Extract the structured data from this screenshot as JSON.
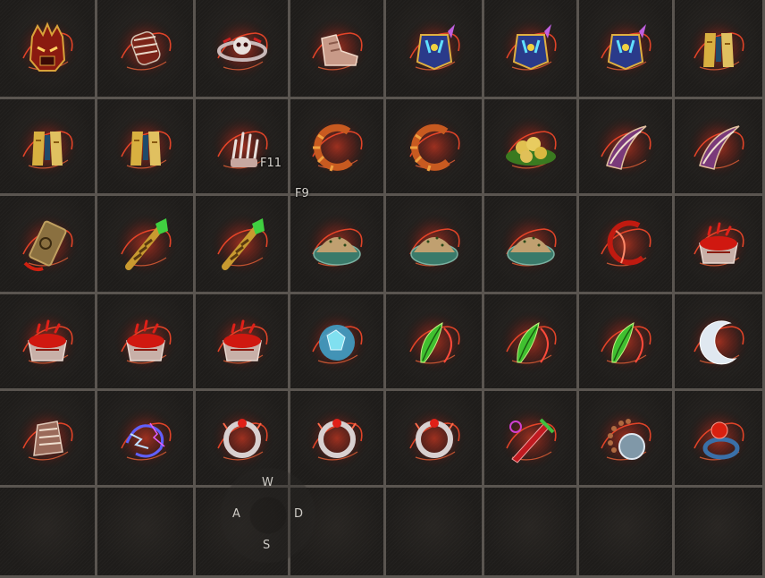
{
  "inventory": {
    "rows": [
      [
        "demon-helmet-icon",
        "armored-gauntlet-icon",
        "skull-belt-icon",
        "leather-boots-icon",
        "jeweled-armor-icon",
        "jeweled-armor-icon",
        "jeweled-armor-icon",
        "gold-robe-icon"
      ],
      [
        "gold-robe-icon",
        "gold-robe-icon",
        "skeletal-glove-icon",
        "spiked-bracelet-icon",
        "spiked-bracelet-icon",
        "fruit-bowl-icon",
        "curved-blade-icon",
        "curved-blade-icon"
      ],
      [
        "ancient-scroll-icon",
        "jade-scepter-icon",
        "jade-scepter-icon",
        "spice-bowl-icon",
        "spice-bowl-icon",
        "spice-bowl-icon",
        "crimson-ring-icon",
        "blood-cauldron-icon"
      ],
      [
        "blood-cauldron-icon",
        "blood-cauldron-icon",
        "blood-cauldron-icon",
        "ice-crystal-icon",
        "green-feather-icon",
        "green-feather-icon",
        "green-feather-icon",
        "silver-crescent-icon"
      ],
      [
        "bone-gauntlet-icon",
        "lightning-dragon-icon",
        "silver-ring-icon",
        "silver-ring-icon",
        "silver-ring-icon",
        "venom-dagger-icon",
        "bead-necklace-icon",
        "ruby-ring-icon"
      ],
      [
        "",
        "",
        "",
        "",
        "",
        "",
        "",
        ""
      ]
    ]
  },
  "hints": {
    "f11": "F11",
    "f9": "F9"
  },
  "dpad": {
    "up": "W",
    "left": "A",
    "right": "D",
    "down": "S"
  },
  "colors": {
    "background": "#242220",
    "grid_line": "#5a5550",
    "glow": "#e0341c"
  }
}
